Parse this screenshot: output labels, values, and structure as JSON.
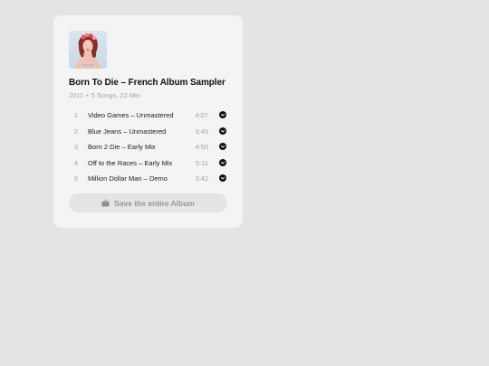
{
  "album": {
    "title": "Born To Die – French Album Sampler",
    "year": "2011",
    "separator": "•",
    "summary": "5 Songs, 22 Min",
    "cover_icon": "album-cover-photo"
  },
  "tracks": [
    {
      "number": "1",
      "title": "Video Games – Unmastered",
      "duration": "4:07"
    },
    {
      "number": "2",
      "title": "Blue Jeans – Unmastered",
      "duration": "3:45"
    },
    {
      "number": "3",
      "title": "Born 2 Die – Early Mix",
      "duration": "4:50"
    },
    {
      "number": "4",
      "title": "Off to the Races – Early Mix",
      "duration": "5:11"
    },
    {
      "number": "5",
      "title": "Million Dollar Man – Demo",
      "duration": "3:42"
    }
  ],
  "save_button": {
    "label": "Save the entire Album",
    "icon": "briefcase-icon"
  },
  "colors": {
    "background": "#e4e4e6",
    "card": "#f4f4f5",
    "button": "#e4e4e6",
    "muted_text": "#a3a3a8",
    "primary_text": "#111111"
  }
}
